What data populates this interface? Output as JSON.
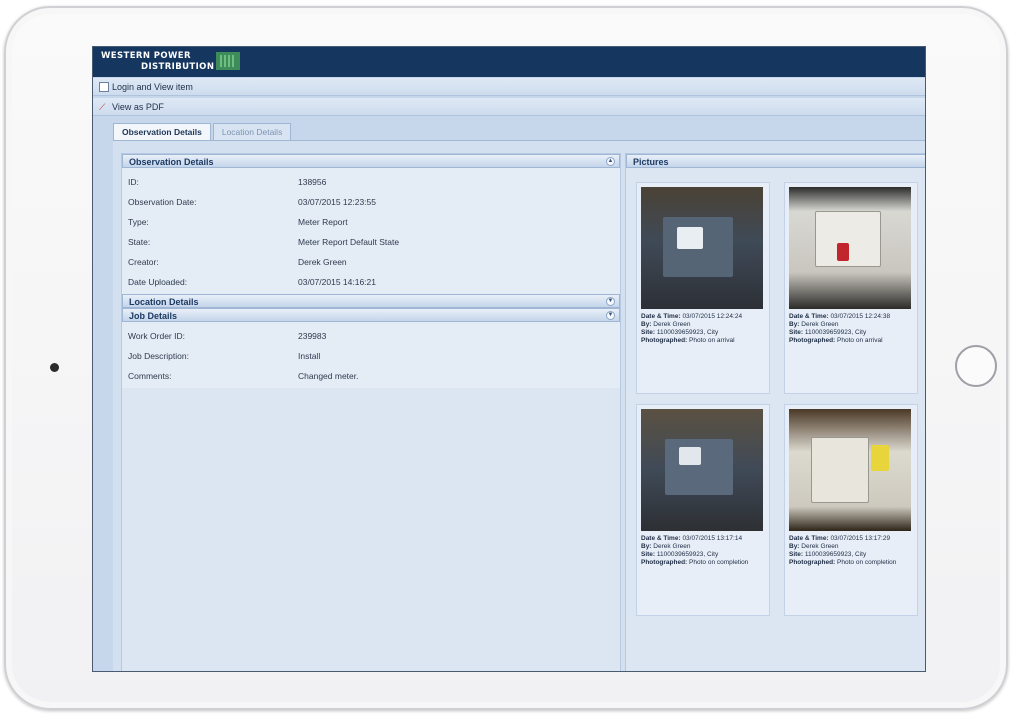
{
  "brand": {
    "line1": "WESTERN POWER",
    "line2": "DISTRIBUTION"
  },
  "toolbar": {
    "login_label": "Login and View item",
    "pdf_label": "View as PDF"
  },
  "tabs": [
    {
      "label": "Observation Details",
      "active": true
    },
    {
      "label": "Location Details",
      "active": false
    }
  ],
  "observation": {
    "title": "Observation Details",
    "rows": [
      {
        "label": "ID:",
        "value": "138956"
      },
      {
        "label": "Observation Date:",
        "value": "03/07/2015 12:23:55"
      },
      {
        "label": "Type:",
        "value": "Meter Report"
      },
      {
        "label": "State:",
        "value": "Meter Report Default State"
      },
      {
        "label": "Creator:",
        "value": "Derek Green"
      },
      {
        "label": "Date Uploaded:",
        "value": "03/07/2015 14:16:21"
      }
    ]
  },
  "location": {
    "title": "Location Details"
  },
  "job": {
    "title": "Job Details",
    "rows": [
      {
        "label": "Work Order ID:",
        "value": "239983"
      },
      {
        "label": "Job Description:",
        "value": "Install"
      },
      {
        "label": "Comments:",
        "value": "Changed meter."
      }
    ]
  },
  "pictures": {
    "title": "Pictures",
    "items": [
      {
        "date_label": "Date & Time:",
        "date": "03/07/2015 12:24:24",
        "by_label": "By:",
        "by": "Derek Green",
        "site_label": "Site:",
        "site": "1100039659923, City",
        "photo_label": "Photographed:",
        "photo": "Photo on arrival"
      },
      {
        "date_label": "Date & Time:",
        "date": "03/07/2015 12:24:38",
        "by_label": "By:",
        "by": "Derek Green",
        "site_label": "Site:",
        "site": "1100039659923, City",
        "photo_label": "Photographed:",
        "photo": "Photo on arrival"
      },
      {
        "date_label": "Date & Time:",
        "date": "03/07/2015 13:17:14",
        "by_label": "By:",
        "by": "Derek Green",
        "site_label": "Site:",
        "site": "1100039659923, City",
        "photo_label": "Photographed:",
        "photo": "Photo on completion"
      },
      {
        "date_label": "Date & Time:",
        "date": "03/07/2015 13:17:29",
        "by_label": "By:",
        "by": "Derek Green",
        "site_label": "Site:",
        "site": "1100039659923, City",
        "photo_label": "Photographed:",
        "photo": "Photo on completion"
      }
    ]
  },
  "colors": {
    "header": "#14365f",
    "panel_bg": "#dce6f3",
    "accent_green": "#3d8c5a"
  }
}
